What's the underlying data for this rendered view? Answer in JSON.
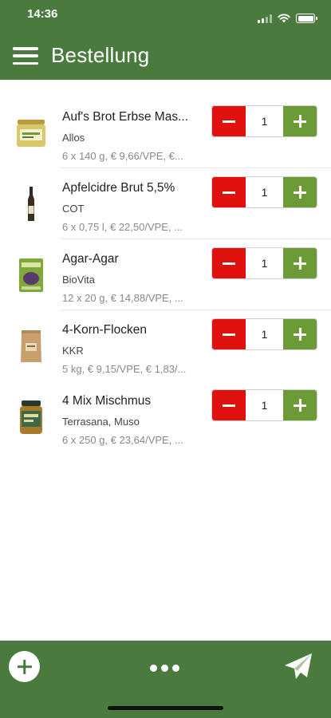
{
  "status_bar": {
    "time": "14:36"
  },
  "header": {
    "title": "Bestellung",
    "menu_icon": "hamburger-menu-icon"
  },
  "colors": {
    "primary": "#4a7a3e",
    "minus": "#e0120f",
    "plus": "#6b9a36"
  },
  "products": [
    {
      "name": "Auf's Brot Erbse Mas...",
      "brand": "Allos",
      "info": "6 x 140 g, € 9,66/VPE, €...",
      "quantity": "1",
      "image": "jar-spread-image"
    },
    {
      "name": "Apfelcidre Brut 5,5%",
      "brand": "COT",
      "info": "6 x 0,75 l, € 22,50/VPE, ...",
      "quantity": "1",
      "image": "bottle-image"
    },
    {
      "name": "Agar-Agar",
      "brand": "BioVita",
      "info": "12 x 20 g, € 14,88/VPE, ...",
      "quantity": "1",
      "image": "package-image"
    },
    {
      "name": "4-Korn-Flocken",
      "brand": "KKR",
      "info": "5 kg, € 9,15/VPE, € 1,83/...",
      "quantity": "1",
      "image": "paper-bag-image"
    },
    {
      "name": "4 Mix Mischmus",
      "brand": "Terrasana, Muso",
      "info": "6 x 250 g, € 23,64/VPE, ...",
      "quantity": "1",
      "image": "jar-image"
    }
  ],
  "bottom_bar": {
    "add_icon": "add-circle-icon",
    "more_icon": "more-dots-icon",
    "send_icon": "send-paper-plane-icon"
  }
}
